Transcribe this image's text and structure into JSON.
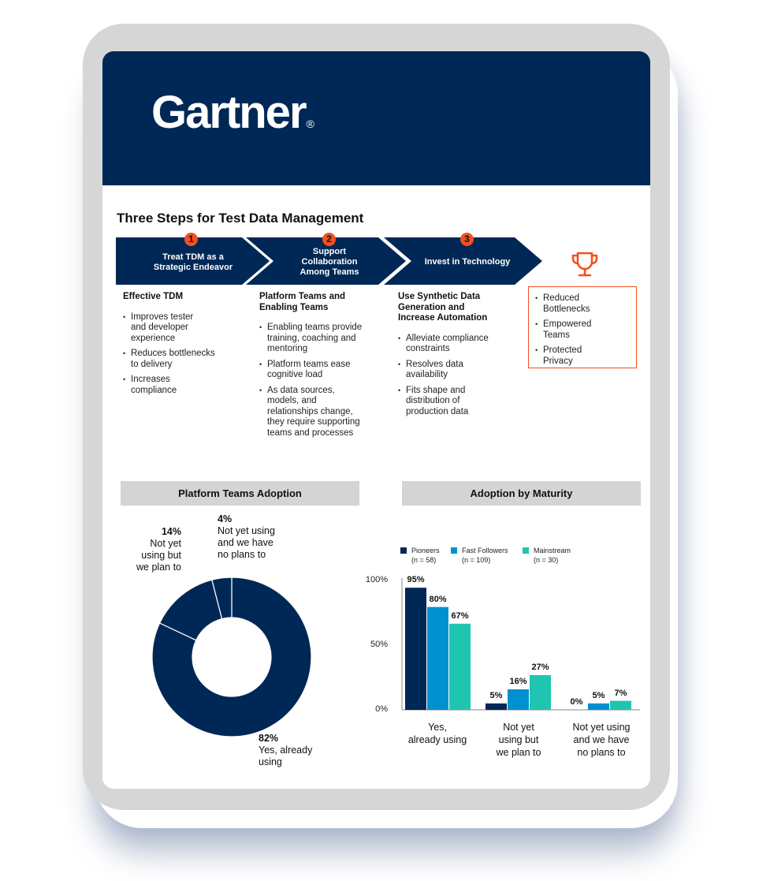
{
  "brand": {
    "logo_text": "Gartner",
    "registered_mark": "®",
    "banner_color": "#002856",
    "accent_color": "#f2501f"
  },
  "infographic": {
    "title": "Three Steps for Test Data Management",
    "steps": [
      {
        "number": "1",
        "label_lines": [
          "Treat TDM as a",
          "Strategic Endeavor"
        ],
        "heading_lines": [
          "Effective TDM"
        ],
        "bullets": [
          [
            "Improves tester",
            "and developer",
            "experience"
          ],
          [
            "Reduces bottlenecks",
            "to delivery"
          ],
          [
            "Increases",
            "compliance"
          ]
        ]
      },
      {
        "number": "2",
        "label_lines": [
          "Support",
          "Collaboration",
          "Among Teams"
        ],
        "heading_lines": [
          "Platform Teams and",
          "Enabling Teams"
        ],
        "bullets": [
          [
            "Enabling teams provide",
            "training, coaching and",
            "mentoring"
          ],
          [
            "Platform teams ease",
            "cognitive load"
          ],
          [
            "As data sources,",
            "models, and",
            "relationships change,",
            "they require supporting",
            "teams and processes"
          ]
        ]
      },
      {
        "number": "3",
        "label_lines": [
          "Invest in Technology"
        ],
        "heading_lines": [
          "Use Synthetic Data",
          "Generation and",
          "Increase Automation"
        ],
        "bullets": [
          [
            "Alleviate compliance",
            "constraints"
          ],
          [
            "Resolves data",
            "availability"
          ],
          [
            "Fits shape and",
            "distribution of",
            "production data"
          ]
        ]
      }
    ],
    "outcome": {
      "icon": "trophy-icon",
      "bullets": [
        [
          "Reduced",
          "Bottlenecks"
        ],
        [
          "Empowered",
          "Teams"
        ],
        [
          "Protected",
          "Privacy"
        ]
      ]
    }
  },
  "chart_data": [
    {
      "type": "pie",
      "title": "Platform Teams Adoption",
      "donut": true,
      "slices": [
        {
          "label": "Yes, already using",
          "value": 82,
          "value_label": "82%",
          "label_lines": [
            "Yes, already",
            "using"
          ],
          "color": "#002856"
        },
        {
          "label": "Not yet using but we plan to",
          "value": 14,
          "value_label": "14%",
          "label_lines": [
            "Not yet",
            "using but",
            "we plan to"
          ],
          "color": "#002856"
        },
        {
          "label": "Not yet using and we have no plans to",
          "value": 4,
          "value_label": "4%",
          "label_lines": [
            "Not yet using",
            "and we have",
            "no plans to"
          ],
          "color": "#002856"
        }
      ]
    },
    {
      "type": "bar",
      "title": "Adoption by Maturity",
      "categories": [
        "Yes, already using",
        "Not yet using but we plan to",
        "Not yet using and we have no plans to"
      ],
      "category_lines": [
        [
          "Yes,",
          "already using"
        ],
        [
          "Not yet",
          "using but",
          "we plan to"
        ],
        [
          "Not yet using",
          "and we have",
          "no plans to"
        ]
      ],
      "series": [
        {
          "name": "Pioneers",
          "n_label": "(n = 58)",
          "color": "#002856",
          "values": [
            95,
            5,
            0
          ]
        },
        {
          "name": "Fast Followers",
          "n_label": "(n = 109)",
          "color": "#0091d1",
          "values": [
            80,
            16,
            5
          ]
        },
        {
          "name": "Mainstream",
          "n_label": "(n = 30)",
          "color": "#1fc5b0",
          "values": [
            67,
            27,
            7
          ]
        }
      ],
      "yticks": [
        "100%",
        "50%",
        "0%"
      ],
      "ylim": [
        0,
        100
      ],
      "legend": "top-left",
      "xlabel": "",
      "ylabel": ""
    }
  ]
}
